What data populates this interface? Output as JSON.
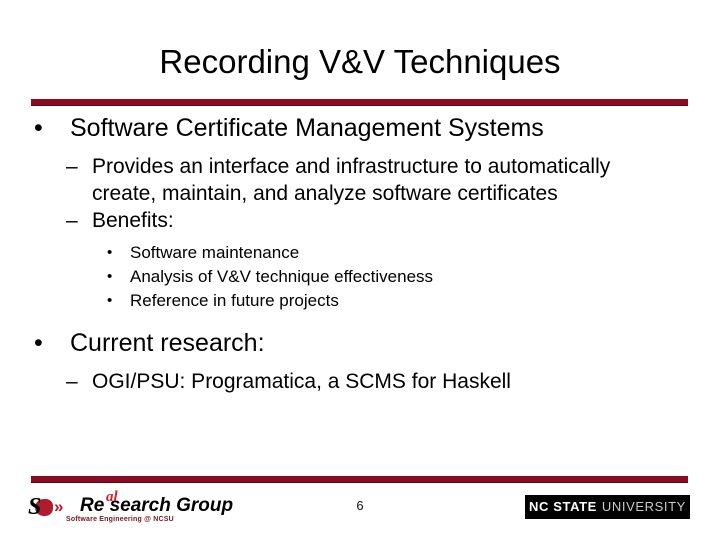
{
  "slide": {
    "title": "Recording V&V Techniques",
    "page_number": "6",
    "accent_color": "#8B0B20",
    "background_color": "#FFFFFF",
    "text_color": "#000000"
  },
  "content": {
    "bullet1": {
      "marker": "•",
      "text": "Software Certificate Management Systems",
      "sub": [
        {
          "marker": "–",
          "text": "Provides an interface and infrastructure to automatically create, maintain, and analyze software certificates"
        },
        {
          "marker": "–",
          "text": "Benefits:",
          "sub": [
            {
              "marker": "•",
              "text": "Software maintenance"
            },
            {
              "marker": "•",
              "text": "Analysis of V&V technique effectiveness"
            },
            {
              "marker": "•",
              "text": "Reference in future projects"
            }
          ]
        }
      ]
    },
    "bullet2": {
      "marker": "•",
      "text": "Current research:",
      "sub": [
        {
          "marker": "–",
          "text": "OGI/PSU: Programatica, a SCMS for Haskell"
        }
      ]
    }
  },
  "footer": {
    "research_group_logo": {
      "s_letter": "S",
      "chevrons": "»",
      "word": "Re search Group",
      "accent": "al",
      "tagline": "Software Engineering @ NCSU",
      "mark_color": "#B01C2E"
    },
    "university_logo": {
      "bold_text": "NC STATE",
      "light_text": "UNIVERSITY",
      "background_color": "#000000"
    }
  }
}
